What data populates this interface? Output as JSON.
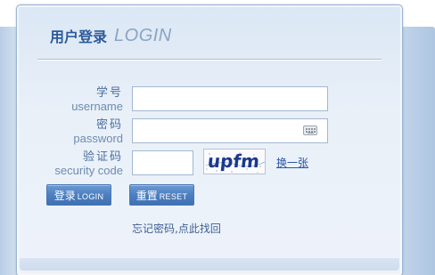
{
  "title": {
    "cn": "用户登录",
    "en": "LOGIN"
  },
  "fields": {
    "username": {
      "label_cn": "学号",
      "label_en": "username",
      "value": "",
      "placeholder": ""
    },
    "password": {
      "label_cn": "密码",
      "label_en": "password",
      "value": "",
      "placeholder": ""
    },
    "security_code": {
      "label_cn": "验证码",
      "label_en": "security code",
      "value": "",
      "placeholder": ""
    }
  },
  "captcha": {
    "text": "upfm",
    "refresh_label": "换一张"
  },
  "buttons": {
    "login_cn": "登录",
    "login_en": "LOGIN",
    "reset_cn": "重置",
    "reset_en": "RESET"
  },
  "forgot_password": "忘记密码,点此找回",
  "icons": {
    "password_field": "keyboard-icon"
  },
  "colors": {
    "accent": "#2d5a9c",
    "button": "#4d7fc0",
    "label": "#4a6ea1"
  }
}
